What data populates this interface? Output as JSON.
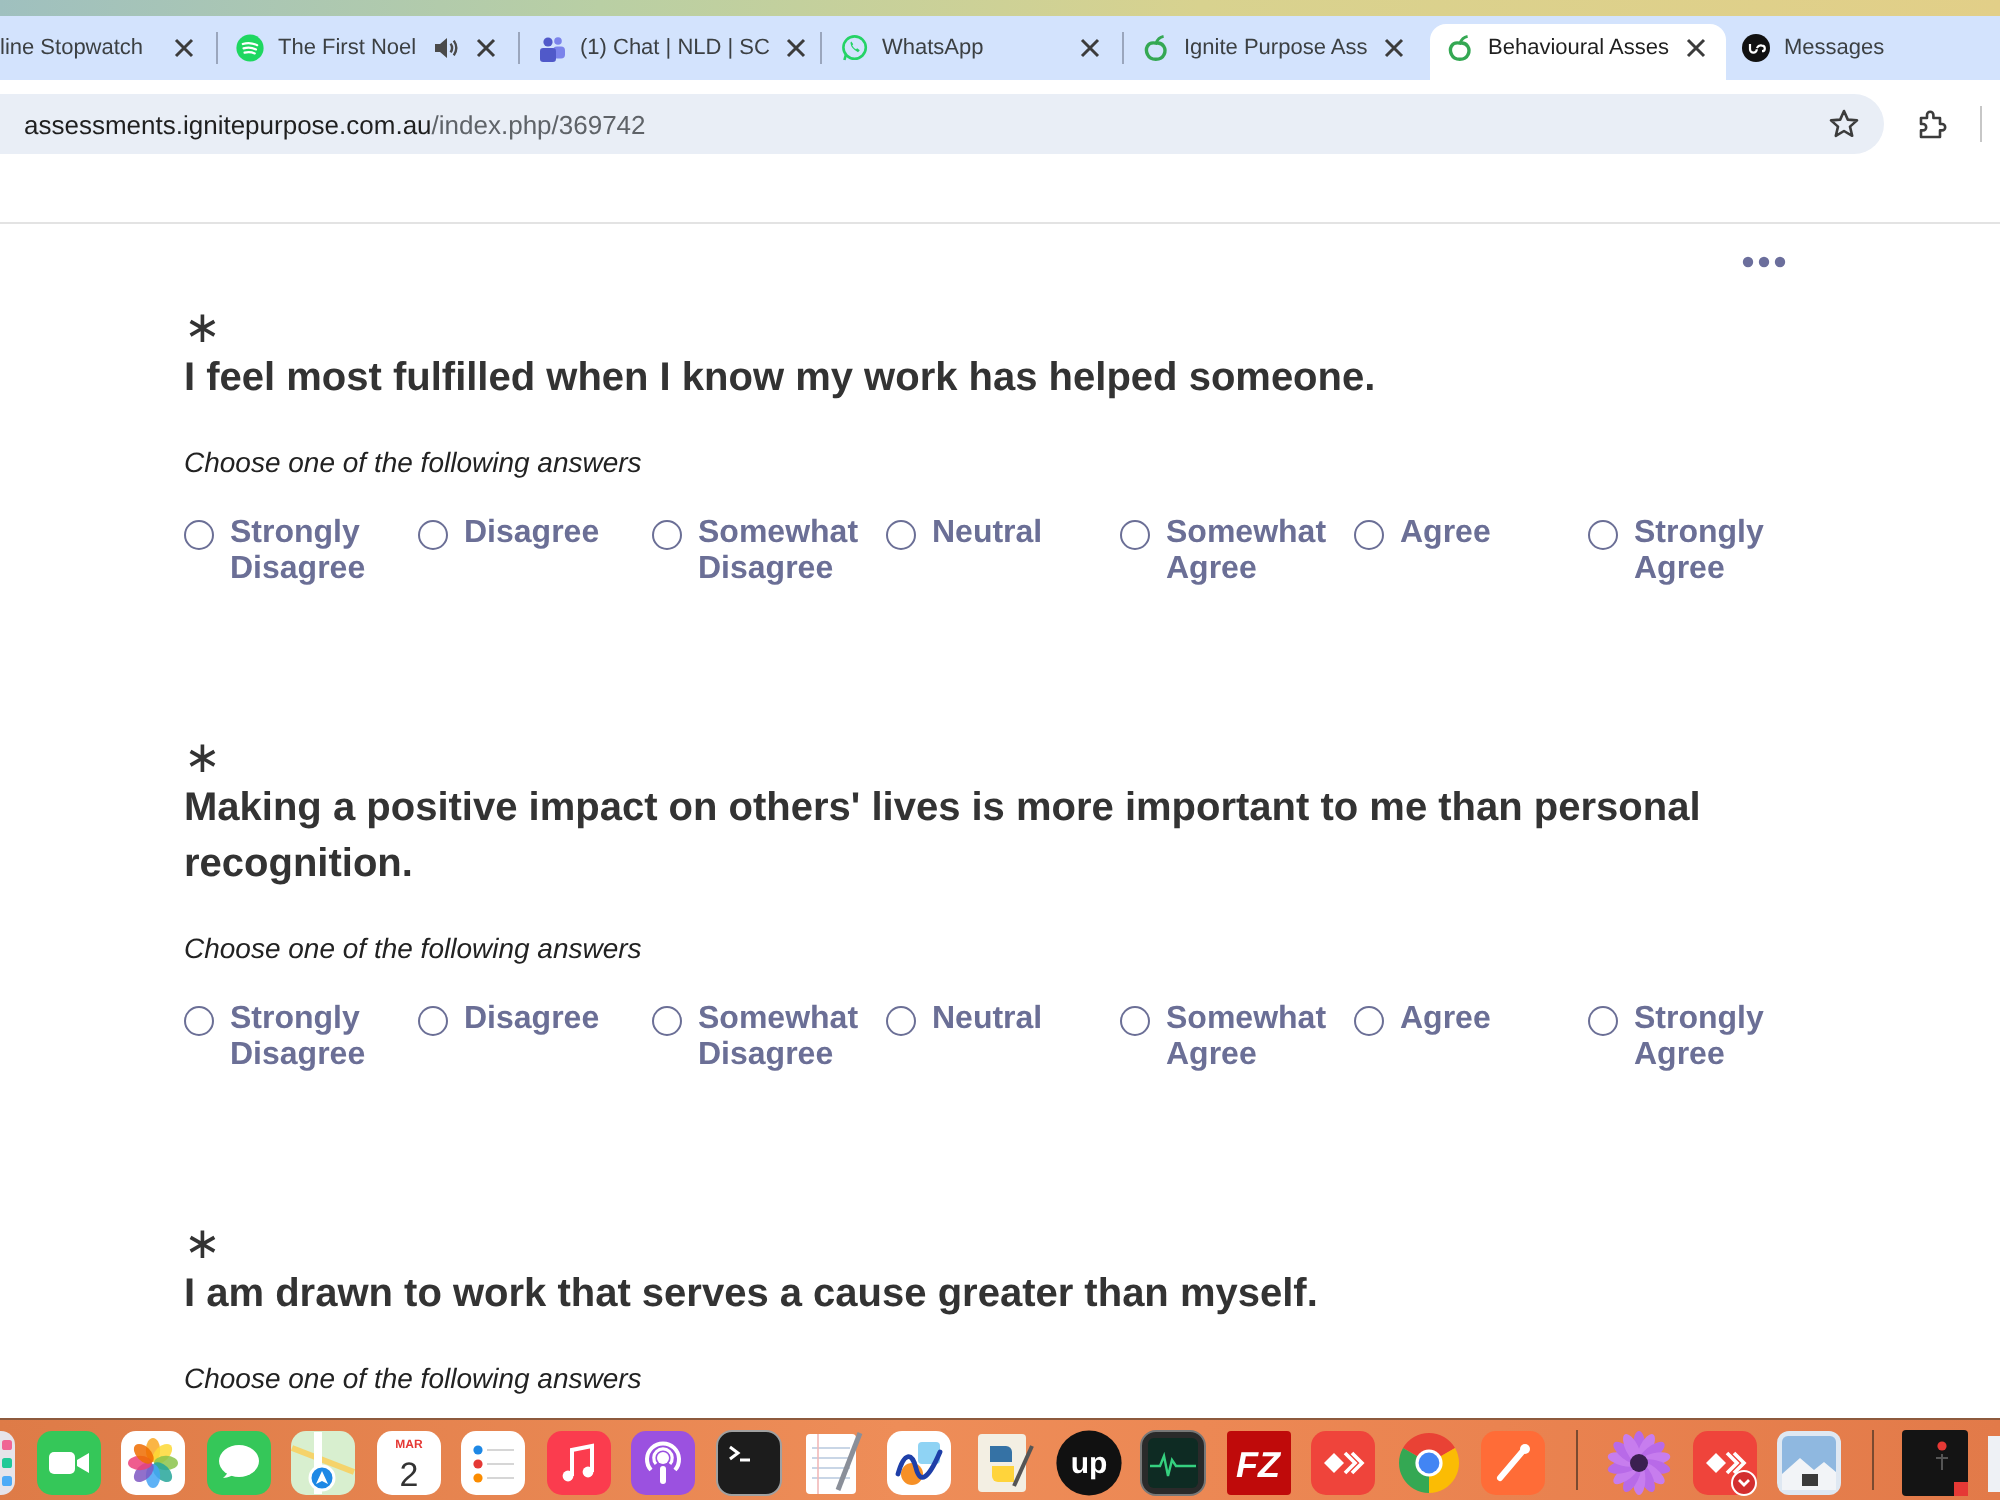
{
  "browser": {
    "tabs": [
      {
        "title": "line Stopwatch",
        "selected": false,
        "audio": false,
        "closable": true
      },
      {
        "title": "The First Noel",
        "favicon": {
          "kind": "waves"
        },
        "selected": false,
        "audio": true,
        "closable": true
      },
      {
        "title": "(1) Chat | NLD | SC",
        "favicon": {
          "kind": "people"
        },
        "selected": false,
        "audio": false,
        "closable": true
      },
      {
        "title": "WhatsApp",
        "favicon": {
          "kind": "phone"
        },
        "selected": false,
        "audio": false,
        "closable": true
      },
      {
        "title": "Ignite Purpose Ass",
        "favicon": {
          "kind": "sprout"
        },
        "selected": false,
        "audio": false,
        "closable": true
      },
      {
        "title": "Behavioural Asses",
        "favicon": {
          "kind": "sprout"
        },
        "selected": true,
        "audio": false,
        "closable": true
      },
      {
        "title": "Messages",
        "favicon": {
          "kind": "logo"
        },
        "selected": false,
        "audio": false,
        "closable": false
      }
    ]
  },
  "toolbar": {
    "url_host": "assessments.ignitepurpose.com.au",
    "url_path": "/index.php/369742",
    "bookmarked": false
  },
  "page": {
    "questions": [
      {
        "required_mark": "∗",
        "text": "I feel most fulfilled when I know my work has helped someone.",
        "hint": "Choose one of the following answers",
        "options": [
          {
            "label": "Strongly Disagree",
            "selected": false
          },
          {
            "label": "Disagree",
            "selected": false
          },
          {
            "label": "Somewhat Disagree",
            "selected": false
          },
          {
            "label": "Neutral",
            "selected": false
          },
          {
            "label": "Somewhat Agree",
            "selected": false
          },
          {
            "label": "Agree",
            "selected": false
          },
          {
            "label": "Strongly Agree",
            "selected": false
          }
        ]
      },
      {
        "required_mark": "∗",
        "text": "Making a positive impact on others' lives is more important to me than personal recognition.",
        "hint": "Choose one of the following answers",
        "options": [
          {
            "label": "Strongly Disagree",
            "selected": false
          },
          {
            "label": "Disagree",
            "selected": false
          },
          {
            "label": "Somewhat Disagree",
            "selected": false
          },
          {
            "label": "Neutral",
            "selected": false
          },
          {
            "label": "Somewhat Agree",
            "selected": false
          },
          {
            "label": "Agree",
            "selected": false
          },
          {
            "label": "Strongly Agree",
            "selected": false
          }
        ]
      },
      {
        "required_mark": "∗",
        "text": "I am drawn to work that serves a cause greater than myself.",
        "hint": "Choose one of the following answers"
      }
    ]
  },
  "dock": {
    "items": [
      {
        "kind": "appgrid"
      },
      {
        "kind": "video"
      },
      {
        "kind": "photos"
      },
      {
        "kind": "chat"
      },
      {
        "kind": "maps"
      },
      {
        "kind": "calendar",
        "month": "MAR",
        "day": "2"
      },
      {
        "kind": "reminders"
      },
      {
        "kind": "music"
      },
      {
        "kind": "podcast"
      },
      {
        "kind": "terminal"
      },
      {
        "kind": "notes"
      },
      {
        "kind": "freeform"
      },
      {
        "kind": "python"
      },
      {
        "kind": "logo",
        "text": "up"
      },
      {
        "kind": "monitor"
      },
      {
        "kind": "lettermark",
        "text": "FZ"
      },
      {
        "kind": "remote"
      },
      {
        "kind": "browser"
      },
      {
        "kind": "pen"
      },
      {
        "kind": "separator"
      },
      {
        "kind": "flower"
      },
      {
        "kind": "remotebadge"
      },
      {
        "kind": "landscape"
      },
      {
        "kind": "separator"
      },
      {
        "kind": "window"
      },
      {
        "kind": "partial"
      }
    ]
  }
}
